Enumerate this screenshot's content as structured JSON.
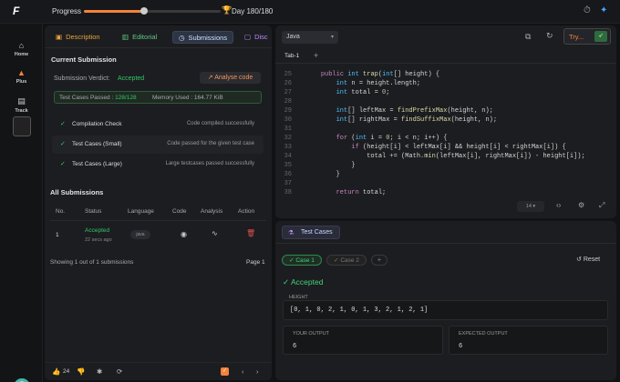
{
  "topbar": {
    "logo": "F",
    "progress_label": "Progress",
    "progress_value": 0.44,
    "day_label": "Day 180/180",
    "colors": {
      "accent": "#f5833b",
      "trophy": "#f0c24a"
    }
  },
  "sidebar": {
    "items": [
      {
        "label": "Home",
        "icon": "home-icon"
      },
      {
        "label": "Plus",
        "icon": "plus-flame-icon"
      },
      {
        "label": "Track",
        "icon": "track-icon"
      }
    ]
  },
  "left": {
    "tabs": [
      {
        "label": "Description",
        "icon": "document-icon"
      },
      {
        "label": "Editorial",
        "icon": "book-icon"
      },
      {
        "label": "Submissions",
        "icon": "clock-icon"
      },
      {
        "label": "Disc",
        "icon": "discussion-icon"
      }
    ],
    "current_title": "Current Submission",
    "verdict_label": "Submission Verdict:",
    "verdict_value": "Accepted",
    "analyse_label": "Analyse code",
    "tests_passed_label": "Test Cases Passed :",
    "tests_passed_value": "128/128",
    "memory_used": "Memory Used : 164.77 KiB",
    "checks": [
      {
        "name": "Compilation Check",
        "desc": "Code compiled successfully"
      },
      {
        "name": "Test Cases (Small)",
        "desc": "Code passed for the given test case"
      },
      {
        "name": "Test Cases (Large)",
        "desc": "Large testcases passed successfully"
      }
    ],
    "all_title": "All Submissions",
    "table": {
      "headers": [
        "No.",
        "Status",
        "Language",
        "Code",
        "Analysis",
        "Action"
      ],
      "rows": [
        {
          "no": "1",
          "status": "Accepted",
          "time": "22 secs ago",
          "lang": "java"
        }
      ]
    },
    "showing": "Showing 1 out of 1 submissions",
    "page": "Page 1",
    "likes": "24"
  },
  "editor": {
    "language": "Java",
    "try_label": "Try...",
    "tab_label": "Tab-1",
    "font_size": "14",
    "lines": [
      {
        "n": "25",
        "text": "    public int trap(int[] height) {"
      },
      {
        "n": "26",
        "text": "        int n = height.length;"
      },
      {
        "n": "27",
        "text": "        int total = 0;"
      },
      {
        "n": "28",
        "text": ""
      },
      {
        "n": "29",
        "text": "        int[] leftMax = findPrefixMax(height, n);"
      },
      {
        "n": "30",
        "text": "        int[] rightMax = findSuffixMax(height, n);"
      },
      {
        "n": "31",
        "text": ""
      },
      {
        "n": "32",
        "text": "        for (int i = 0; i < n; i++) {"
      },
      {
        "n": "33",
        "text": "            if (height[i] < leftMax[i] && height[i] < rightMax[i]) {"
      },
      {
        "n": "34",
        "text": "                total += (Math.min(leftMax[i], rightMax[i]) - height[i]);"
      },
      {
        "n": "35",
        "text": "            }"
      },
      {
        "n": "36",
        "text": "        }"
      },
      {
        "n": "37",
        "text": ""
      },
      {
        "n": "38",
        "text": "        return total;"
      }
    ]
  },
  "tests": {
    "tab_label": "Test Cases",
    "case1": "Case 1",
    "case2": "Case 2",
    "reset_label": "Reset",
    "result": "Accepted",
    "height_label": "HEIGHT",
    "height_value": "[0, 1, 0, 2, 1, 0, 1, 3, 2, 1, 2, 1]",
    "your_output_label": "YOUR OUTPUT",
    "your_output": "6",
    "expected_label": "EXPECTED OUTPUT",
    "expected_output": "6"
  }
}
